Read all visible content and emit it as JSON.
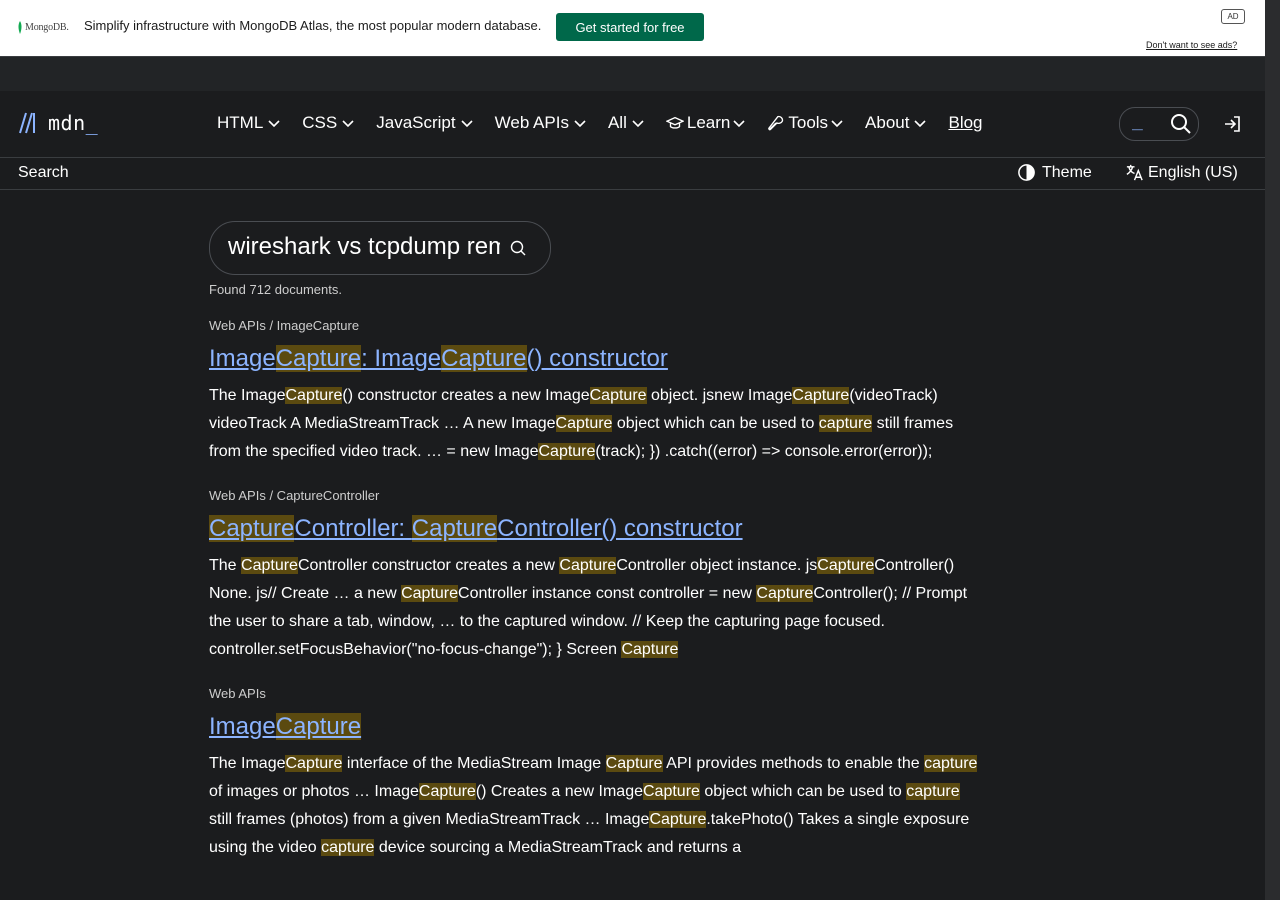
{
  "ad": {
    "brand": "MongoDB.",
    "text": "Simplify infrastructure with MongoDB Atlas, the most popular modern database.",
    "cta": "Get started for free",
    "badge": "AD",
    "optout": "Don't want to see ads?"
  },
  "header": {
    "logo_text": "mdn",
    "logo_cursor": "_",
    "nav": [
      {
        "label": "HTML"
      },
      {
        "label": "CSS"
      },
      {
        "label": "JavaScript"
      },
      {
        "label": "Web APIs"
      },
      {
        "label": "All"
      },
      {
        "label": "Learn"
      },
      {
        "label": "Tools"
      },
      {
        "label": "About"
      }
    ],
    "blog": "Blog",
    "search_shortcut": "_"
  },
  "subbar": {
    "crumb": "Search",
    "theme": "Theme",
    "language": "English (US)"
  },
  "search": {
    "query": "wireshark vs tcpdump remote capture",
    "found": "Found 712 documents."
  },
  "results": [
    {
      "crumbs": "Web APIs / ImageCapture",
      "title": [
        {
          "t": "Image"
        },
        {
          "t": "Capture",
          "h": true
        },
        {
          "t": ": Image"
        },
        {
          "t": "Capture",
          "h": true
        },
        {
          "t": "() constructor"
        }
      ],
      "desc": [
        {
          "t": "The Image"
        },
        {
          "t": "Capture",
          "h": true
        },
        {
          "t": "() constructor creates a new Image"
        },
        {
          "t": "Capture",
          "h": true
        },
        {
          "t": " object. jsnew Image"
        },
        {
          "t": "Capture",
          "h": true
        },
        {
          "t": "(videoTrack) videoTrack A MediaStreamTrack … A new Image"
        },
        {
          "t": "Capture",
          "h": true
        },
        {
          "t": " object which can be used to "
        },
        {
          "t": "capture",
          "h": true
        },
        {
          "t": " still frames from the specified video track. … = new Image"
        },
        {
          "t": "Capture",
          "h": true
        },
        {
          "t": "(track); }) .catch((error) => console.error(error));"
        }
      ]
    },
    {
      "crumbs": "Web APIs / CaptureController",
      "title": [
        {
          "t": "Capture",
          "h": true
        },
        {
          "t": "Controller: "
        },
        {
          "t": "Capture",
          "h": true
        },
        {
          "t": "Controller() constructor"
        }
      ],
      "desc": [
        {
          "t": "The "
        },
        {
          "t": "Capture",
          "h": true
        },
        {
          "t": "Controller constructor creates a new "
        },
        {
          "t": "Capture",
          "h": true
        },
        {
          "t": "Controller object instance. js"
        },
        {
          "t": "Capture",
          "h": true
        },
        {
          "t": "Controller() None. js// Create … a new "
        },
        {
          "t": "Capture",
          "h": true
        },
        {
          "t": "Controller instance const controller = new "
        },
        {
          "t": "Capture",
          "h": true
        },
        {
          "t": "Controller(); // Prompt the user to share a tab, window, … to the captured window. // Keep the capturing page focused. controller.setFocusBehavior(\"no-focus-change\"); } Screen "
        },
        {
          "t": "Capture",
          "h": true
        }
      ]
    },
    {
      "crumbs": "Web APIs",
      "title": [
        {
          "t": "Image"
        },
        {
          "t": "Capture",
          "h": true
        }
      ],
      "desc": [
        {
          "t": "The Image"
        },
        {
          "t": "Capture",
          "h": true
        },
        {
          "t": " interface of the MediaStream Image "
        },
        {
          "t": "Capture",
          "h": true
        },
        {
          "t": " API provides methods to enable the "
        },
        {
          "t": "capture",
          "h": true
        },
        {
          "t": " of images or photos … Image"
        },
        {
          "t": "Capture",
          "h": true
        },
        {
          "t": "() Creates a new Image"
        },
        {
          "t": "Capture",
          "h": true
        },
        {
          "t": " object which can be used to "
        },
        {
          "t": "capture",
          "h": true
        },
        {
          "t": " still frames (photos) from a given MediaStreamTrack … Image"
        },
        {
          "t": "Capture",
          "h": true
        },
        {
          "t": ".takePhoto() Takes a single exposure using the video "
        },
        {
          "t": "capture",
          "h": true
        },
        {
          "t": " device sourcing a MediaStreamTrack and returns a"
        }
      ]
    }
  ]
}
